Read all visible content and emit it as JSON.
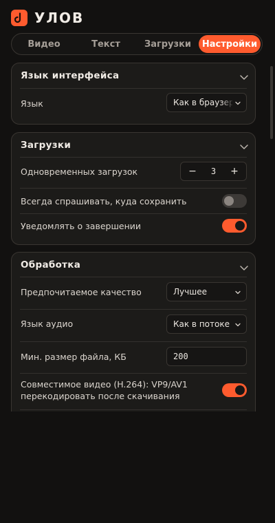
{
  "app": {
    "brand": "УЛОВ"
  },
  "tabs": [
    {
      "label": "Видео",
      "active": false
    },
    {
      "label": "Текст",
      "active": false
    },
    {
      "label": "Загрузки",
      "active": false
    },
    {
      "label": "Настройки",
      "active": true
    }
  ],
  "sections": {
    "interface_language": {
      "title": "Язык интерфейса",
      "language_label": "Язык",
      "language_value": "Как в браузере"
    },
    "downloads": {
      "title": "Загрузки",
      "concurrent_label": "Одновременных загрузок",
      "concurrent_value": "3",
      "minus": "−",
      "plus": "+",
      "ask_location_label": "Всегда спрашивать, куда сохранить",
      "ask_location_enabled": false,
      "notify_label": "Уведомлять о завершении",
      "notify_enabled": true
    },
    "processing": {
      "title": "Обработка",
      "quality_label": "Предпочитаемое качество",
      "quality_value": "Лучшее",
      "audio_lang_label": "Язык аудио",
      "audio_lang_value": "Как в потоке",
      "min_size_label": "Мин. размер файла, КБ",
      "min_size_value": "200",
      "compat_label_line1": "Совместимое видео (H.264): VP9/AV1",
      "compat_label_line2": "перекодировать после скачивания",
      "compat_enabled": true
    }
  },
  "colors": {
    "accent": "#ff5b2e",
    "background": "#121110",
    "card": "#1c1b19"
  }
}
